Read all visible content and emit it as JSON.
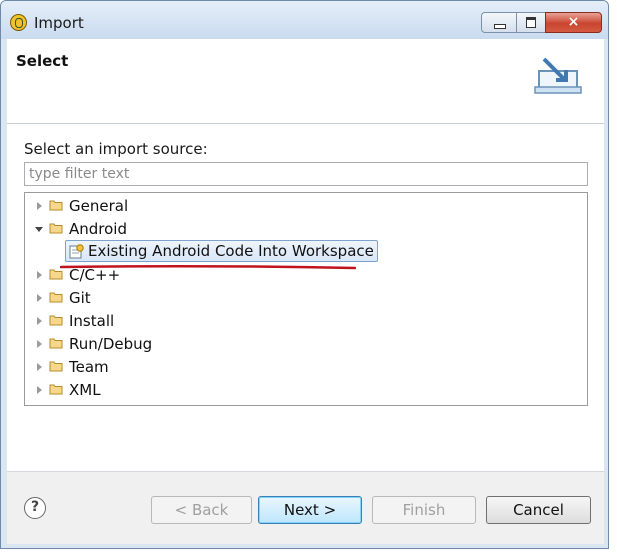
{
  "window": {
    "title": "Import",
    "close_glyph": "×"
  },
  "header": {
    "title": "Select",
    "icon": "import-wizard-icon"
  },
  "main": {
    "source_label": "Select an import source:",
    "filter_placeholder": "type filter text",
    "tree": [
      {
        "label": "General",
        "expanded": false,
        "icon": "folder-icon"
      },
      {
        "label": "Android",
        "expanded": true,
        "icon": "folder-icon"
      },
      {
        "label": "C/C++",
        "expanded": false,
        "icon": "folder-icon"
      },
      {
        "label": "Git",
        "expanded": false,
        "icon": "folder-icon"
      },
      {
        "label": "Install",
        "expanded": false,
        "icon": "folder-icon"
      },
      {
        "label": "Run/Debug",
        "expanded": false,
        "icon": "folder-icon"
      },
      {
        "label": "Team",
        "expanded": false,
        "icon": "folder-icon"
      },
      {
        "label": "XML",
        "expanded": false,
        "icon": "folder-icon"
      }
    ],
    "selected_item": {
      "label": "Existing Android Code Into Workspace",
      "icon": "android-project-icon"
    },
    "annotation_color": "#c0141c"
  },
  "footer": {
    "help_glyph": "?",
    "back": "< Back",
    "next": "Next >",
    "finish": "Finish",
    "cancel": "Cancel"
  }
}
